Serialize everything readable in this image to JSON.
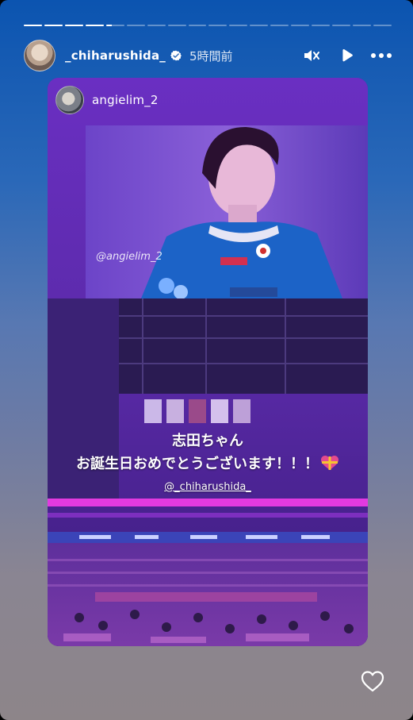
{
  "story": {
    "progress": {
      "segments": 18,
      "completed": 4,
      "current_fraction": 0.3
    },
    "header": {
      "username": "_chiharushida_",
      "time": "5時間前",
      "verified": true,
      "icons": {
        "mute": "speaker-muted-icon",
        "play": "play-icon",
        "more": "more-options-icon"
      }
    },
    "shared_post": {
      "username": "angielim_2",
      "watermark": "@angielim_2"
    },
    "caption": {
      "line1": "志田ちゃん",
      "line2": "お誕生日おめでとうございます！！！",
      "mention": "@_chiharushida_"
    },
    "footer": {
      "like_icon": "heart-outline-icon"
    },
    "colors": {
      "accent_magenta": "#e33ae0",
      "jersey_blue": "#1c63c7"
    }
  }
}
